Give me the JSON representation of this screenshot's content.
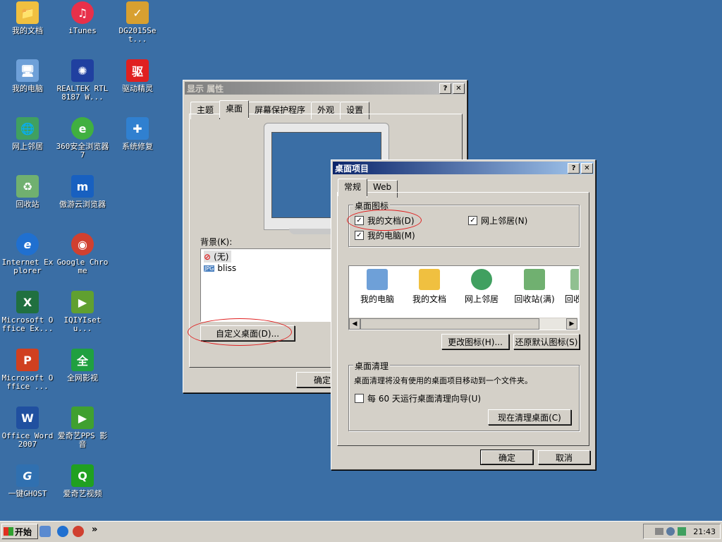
{
  "desktop": {
    "icons": [
      {
        "label": "我的文档",
        "glyph": "📁",
        "color": "#f0c040",
        "icon": "my-documents"
      },
      {
        "label": "iTunes",
        "glyph": "♫",
        "color": "#e8304a",
        "icon": "itunes"
      },
      {
        "label": "DG2015Set...",
        "glyph": "✓",
        "color": "#d8a030",
        "icon": "diskgenius-setup"
      },
      {
        "label": "我的电脑",
        "glyph": "🖥",
        "color": "#6ea0d8",
        "icon": "my-computer"
      },
      {
        "label": "REALTEK RTL8187 W...",
        "glyph": "✺",
        "color": "#2040a0",
        "icon": "realtek-driver"
      },
      {
        "label": "驱动精灵",
        "glyph": "驱",
        "color": "#e02020",
        "icon": "driver-genius"
      },
      {
        "label": "网上邻居",
        "glyph": "🌐",
        "color": "#40a060",
        "icon": "network-places"
      },
      {
        "label": "360安全浏览器7",
        "glyph": "e",
        "color": "#40b040",
        "icon": "360-browser"
      },
      {
        "label": "系统修复",
        "glyph": "✚",
        "color": "#3080d0",
        "icon": "system-repair"
      },
      {
        "label": "回收站",
        "glyph": "♻",
        "color": "#70b070",
        "icon": "recycle-bin"
      },
      {
        "label": "傲游云浏览器",
        "glyph": "m",
        "color": "#1860c0",
        "icon": "maxthon-browser"
      },
      {
        "label": "Internet Explorer",
        "glyph": "e",
        "color": "#2070d0",
        "icon": "internet-explorer"
      },
      {
        "label": "Google Chrome",
        "glyph": "◉",
        "color": "#d04030",
        "icon": "google-chrome"
      },
      {
        "label": "Microsoft Office Ex...",
        "glyph": "X",
        "color": "#207040",
        "icon": "excel"
      },
      {
        "label": "IQIYIsetu...",
        "glyph": "▶",
        "color": "#60a030",
        "icon": "iqiyi-setup"
      },
      {
        "label": "Microsoft Office ...",
        "glyph": "P",
        "color": "#d04020",
        "icon": "powerpoint"
      },
      {
        "label": "全网影视",
        "glyph": "全",
        "color": "#20a040",
        "icon": "quanwang-video"
      },
      {
        "label": "Office Word 2007",
        "glyph": "W",
        "color": "#2050a0",
        "icon": "word"
      },
      {
        "label": "爱奇艺PPS 影音",
        "glyph": "▶",
        "color": "#40a030",
        "icon": "pps-player"
      },
      {
        "label": "一键GHOST",
        "glyph": "G",
        "color": "#3070b0",
        "icon": "one-key-ghost"
      },
      {
        "label": "爱奇艺视频",
        "glyph": "Q",
        "color": "#20a020",
        "icon": "iqiyi-video"
      }
    ]
  },
  "display_props": {
    "title": "显示 属性",
    "tabs": [
      "主题",
      "桌面",
      "屏幕保护程序",
      "外观",
      "设置"
    ],
    "background_label": "背景(K):",
    "bg_items": [
      "(无)",
      "bliss"
    ],
    "customize_btn": "自定义桌面(D)...",
    "ok": "确定"
  },
  "desktop_items": {
    "title": "桌面项目",
    "tabs": [
      "常规",
      "Web"
    ],
    "icons_group": "桌面图标",
    "chk_mydocs": "我的文档(D)",
    "chk_network": "网上邻居(N)",
    "chk_mycomputer": "我的电脑(M)",
    "preview_icons": [
      "我的电脑",
      "我的文档",
      "网上邻居",
      "回收站(满)",
      "回收"
    ],
    "change_icon": "更改图标(H)...",
    "restore_default": "还原默认图标(S)",
    "cleanup_group": "桌面清理",
    "cleanup_desc": "桌面清理将没有使用的桌面项目移动到一个文件夹。",
    "cleanup_chk": "每 60 天运行桌面清理向导(U)",
    "cleanup_now": "现在清理桌面(C)",
    "ok": "确定",
    "cancel": "取消"
  },
  "taskbar": {
    "start": "开始",
    "more": "»",
    "time": "21:43"
  },
  "colors": {
    "desktop": "#3a6ea5",
    "active_title": "#0a246a",
    "highlight_circle": "#e02020"
  }
}
